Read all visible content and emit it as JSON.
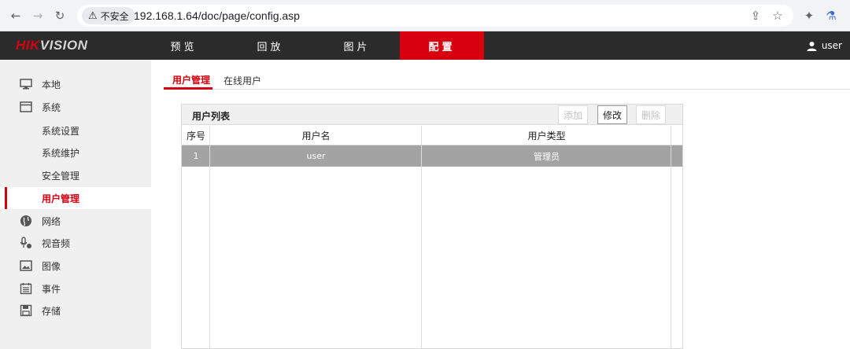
{
  "browser": {
    "security_label": "不安全",
    "url": "192.168.1.64/doc/page/config.asp",
    "user_label": "user"
  },
  "brand": {
    "logo_left": "HIK",
    "logo_right": "VISION",
    "accent": "#d7000f"
  },
  "topnav": {
    "tabs": [
      {
        "label": "预览"
      },
      {
        "label": "回放"
      },
      {
        "label": "图片"
      },
      {
        "label": "配置",
        "active": true
      }
    ]
  },
  "sidebar": {
    "items": [
      {
        "label": "本地",
        "icon": "monitor-icon"
      },
      {
        "label": "系统",
        "icon": "window-icon"
      },
      {
        "label": "系统设置"
      },
      {
        "label": "系统维护"
      },
      {
        "label": "安全管理"
      },
      {
        "label": "用户管理",
        "active": true
      },
      {
        "label": "网络",
        "icon": "globe-icon"
      },
      {
        "label": "视音频",
        "icon": "mic-icon"
      },
      {
        "label": "图像",
        "icon": "image-icon"
      },
      {
        "label": "事件",
        "icon": "calendar-icon"
      },
      {
        "label": "存储",
        "icon": "save-icon"
      }
    ]
  },
  "subtabs": [
    {
      "label": "用户管理",
      "active": true
    },
    {
      "label": "在线用户"
    }
  ],
  "user_panel": {
    "title": "用户列表",
    "add_label": "添加",
    "edit_label": "修改",
    "delete_label": "删除",
    "columns": [
      "序号",
      "用户名",
      "用户类型"
    ],
    "rows": [
      {
        "index": "1",
        "username": "user",
        "type": "管理员"
      }
    ]
  }
}
